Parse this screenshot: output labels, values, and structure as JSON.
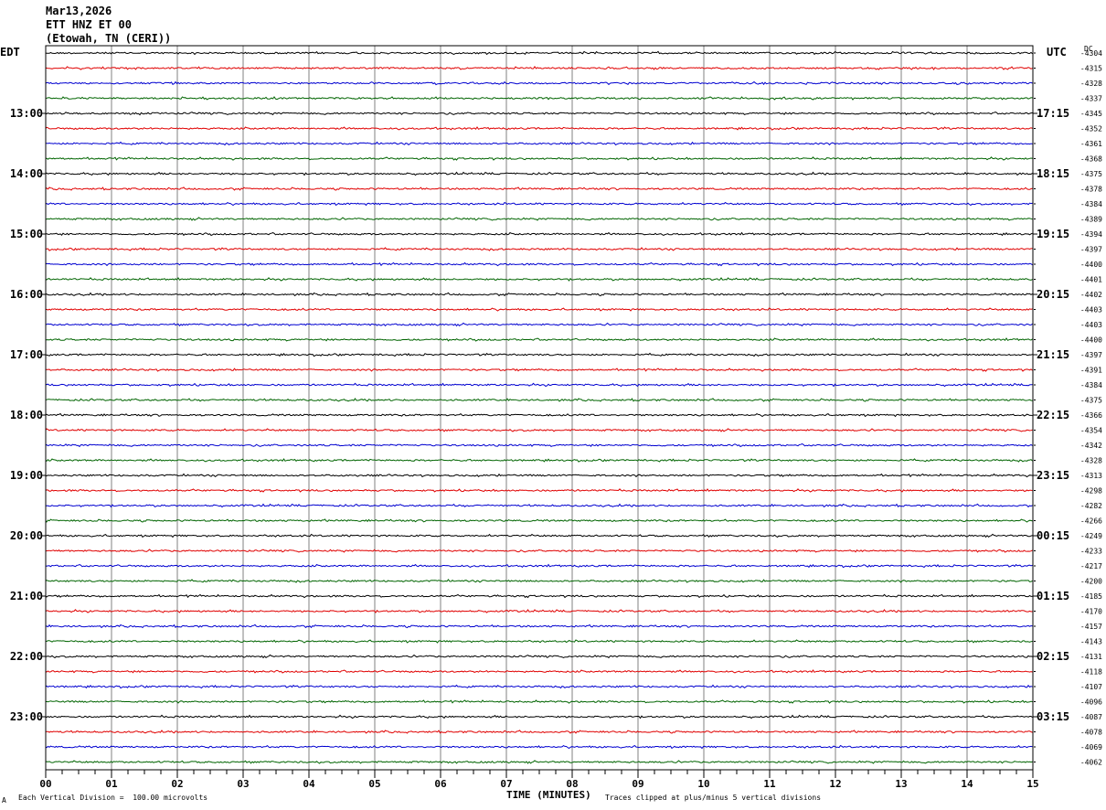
{
  "header": {
    "date": "Mar13,2026",
    "channel": "ETT HNZ ET 00",
    "location": "(Etowah, TN (CERI))",
    "left_tz": "EDT",
    "right_tz": "UTC",
    "dc_label": "DC"
  },
  "footer": {
    "scale_note": "Each Vertical Division =  100.00 microvolts",
    "clip_note": "Traces clipped at plus/minus 5 vertical divisions",
    "corner_mark": "A"
  },
  "colors": {
    "trace_cycle": [
      "#000000",
      "#e00000",
      "#0000d0",
      "#006400"
    ],
    "grid": "#808080"
  },
  "chart_data": {
    "type": "line",
    "xlabel": "TIME (MINUTES)",
    "xlim": [
      0,
      15
    ],
    "x_ticks": [
      "00",
      "01",
      "02",
      "03",
      "04",
      "05",
      "06",
      "07",
      "08",
      "09",
      "10",
      "11",
      "12",
      "13",
      "14",
      "15"
    ],
    "edt_hour_labels": [
      "13:00",
      "14:00",
      "15:00",
      "16:00",
      "17:00",
      "18:00",
      "19:00",
      "20:00",
      "21:00",
      "22:00",
      "23:00"
    ],
    "utc_hour_labels": [
      "17:15",
      "18:15",
      "19:15",
      "20:15",
      "21:15",
      "22:15",
      "23:15",
      "00:15",
      "01:15",
      "02:15",
      "03:15"
    ],
    "first_hour_label_trace": 4,
    "trace_count": 48,
    "dc_offsets": [
      "-4304",
      "-4315",
      "-4328",
      "-4337",
      "-4345",
      "-4352",
      "-4361",
      "-4368",
      "-4375",
      "-4378",
      "-4384",
      "-4389",
      "-4394",
      "-4397",
      "-4400",
      "-4401",
      "-4402",
      "-4403",
      "-4403",
      "-4400",
      "-4397",
      "-4391",
      "-4384",
      "-4375",
      "-4366",
      "-4354",
      "-4342",
      "-4328",
      "-4313",
      "-4298",
      "-4282",
      "-4266",
      "-4249",
      "-4233",
      "-4217",
      "-4200",
      "-4185",
      "-4170",
      "-4157",
      "-4143",
      "-4131",
      "-4118",
      "-4107",
      "-4096",
      "-4087",
      "-4078",
      "-4069",
      "-4062"
    ]
  }
}
